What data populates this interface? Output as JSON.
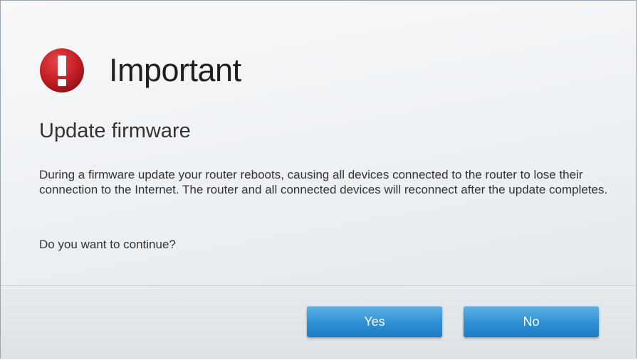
{
  "dialog": {
    "icon": "exclamation-alert-icon",
    "title": "Important",
    "subtitle": "Update firmware",
    "message": "During a firmware update your router reboots, causing all devices connected to the router to lose their connection to the Internet. The router and all connected devices will reconnect after the update completes.",
    "question": "Do you want to continue?"
  },
  "buttons": {
    "yes_label": "Yes",
    "no_label": "No"
  },
  "colors": {
    "alert_red": "#c8202a",
    "button_blue": "#2f8fd3",
    "text": "#333333"
  }
}
